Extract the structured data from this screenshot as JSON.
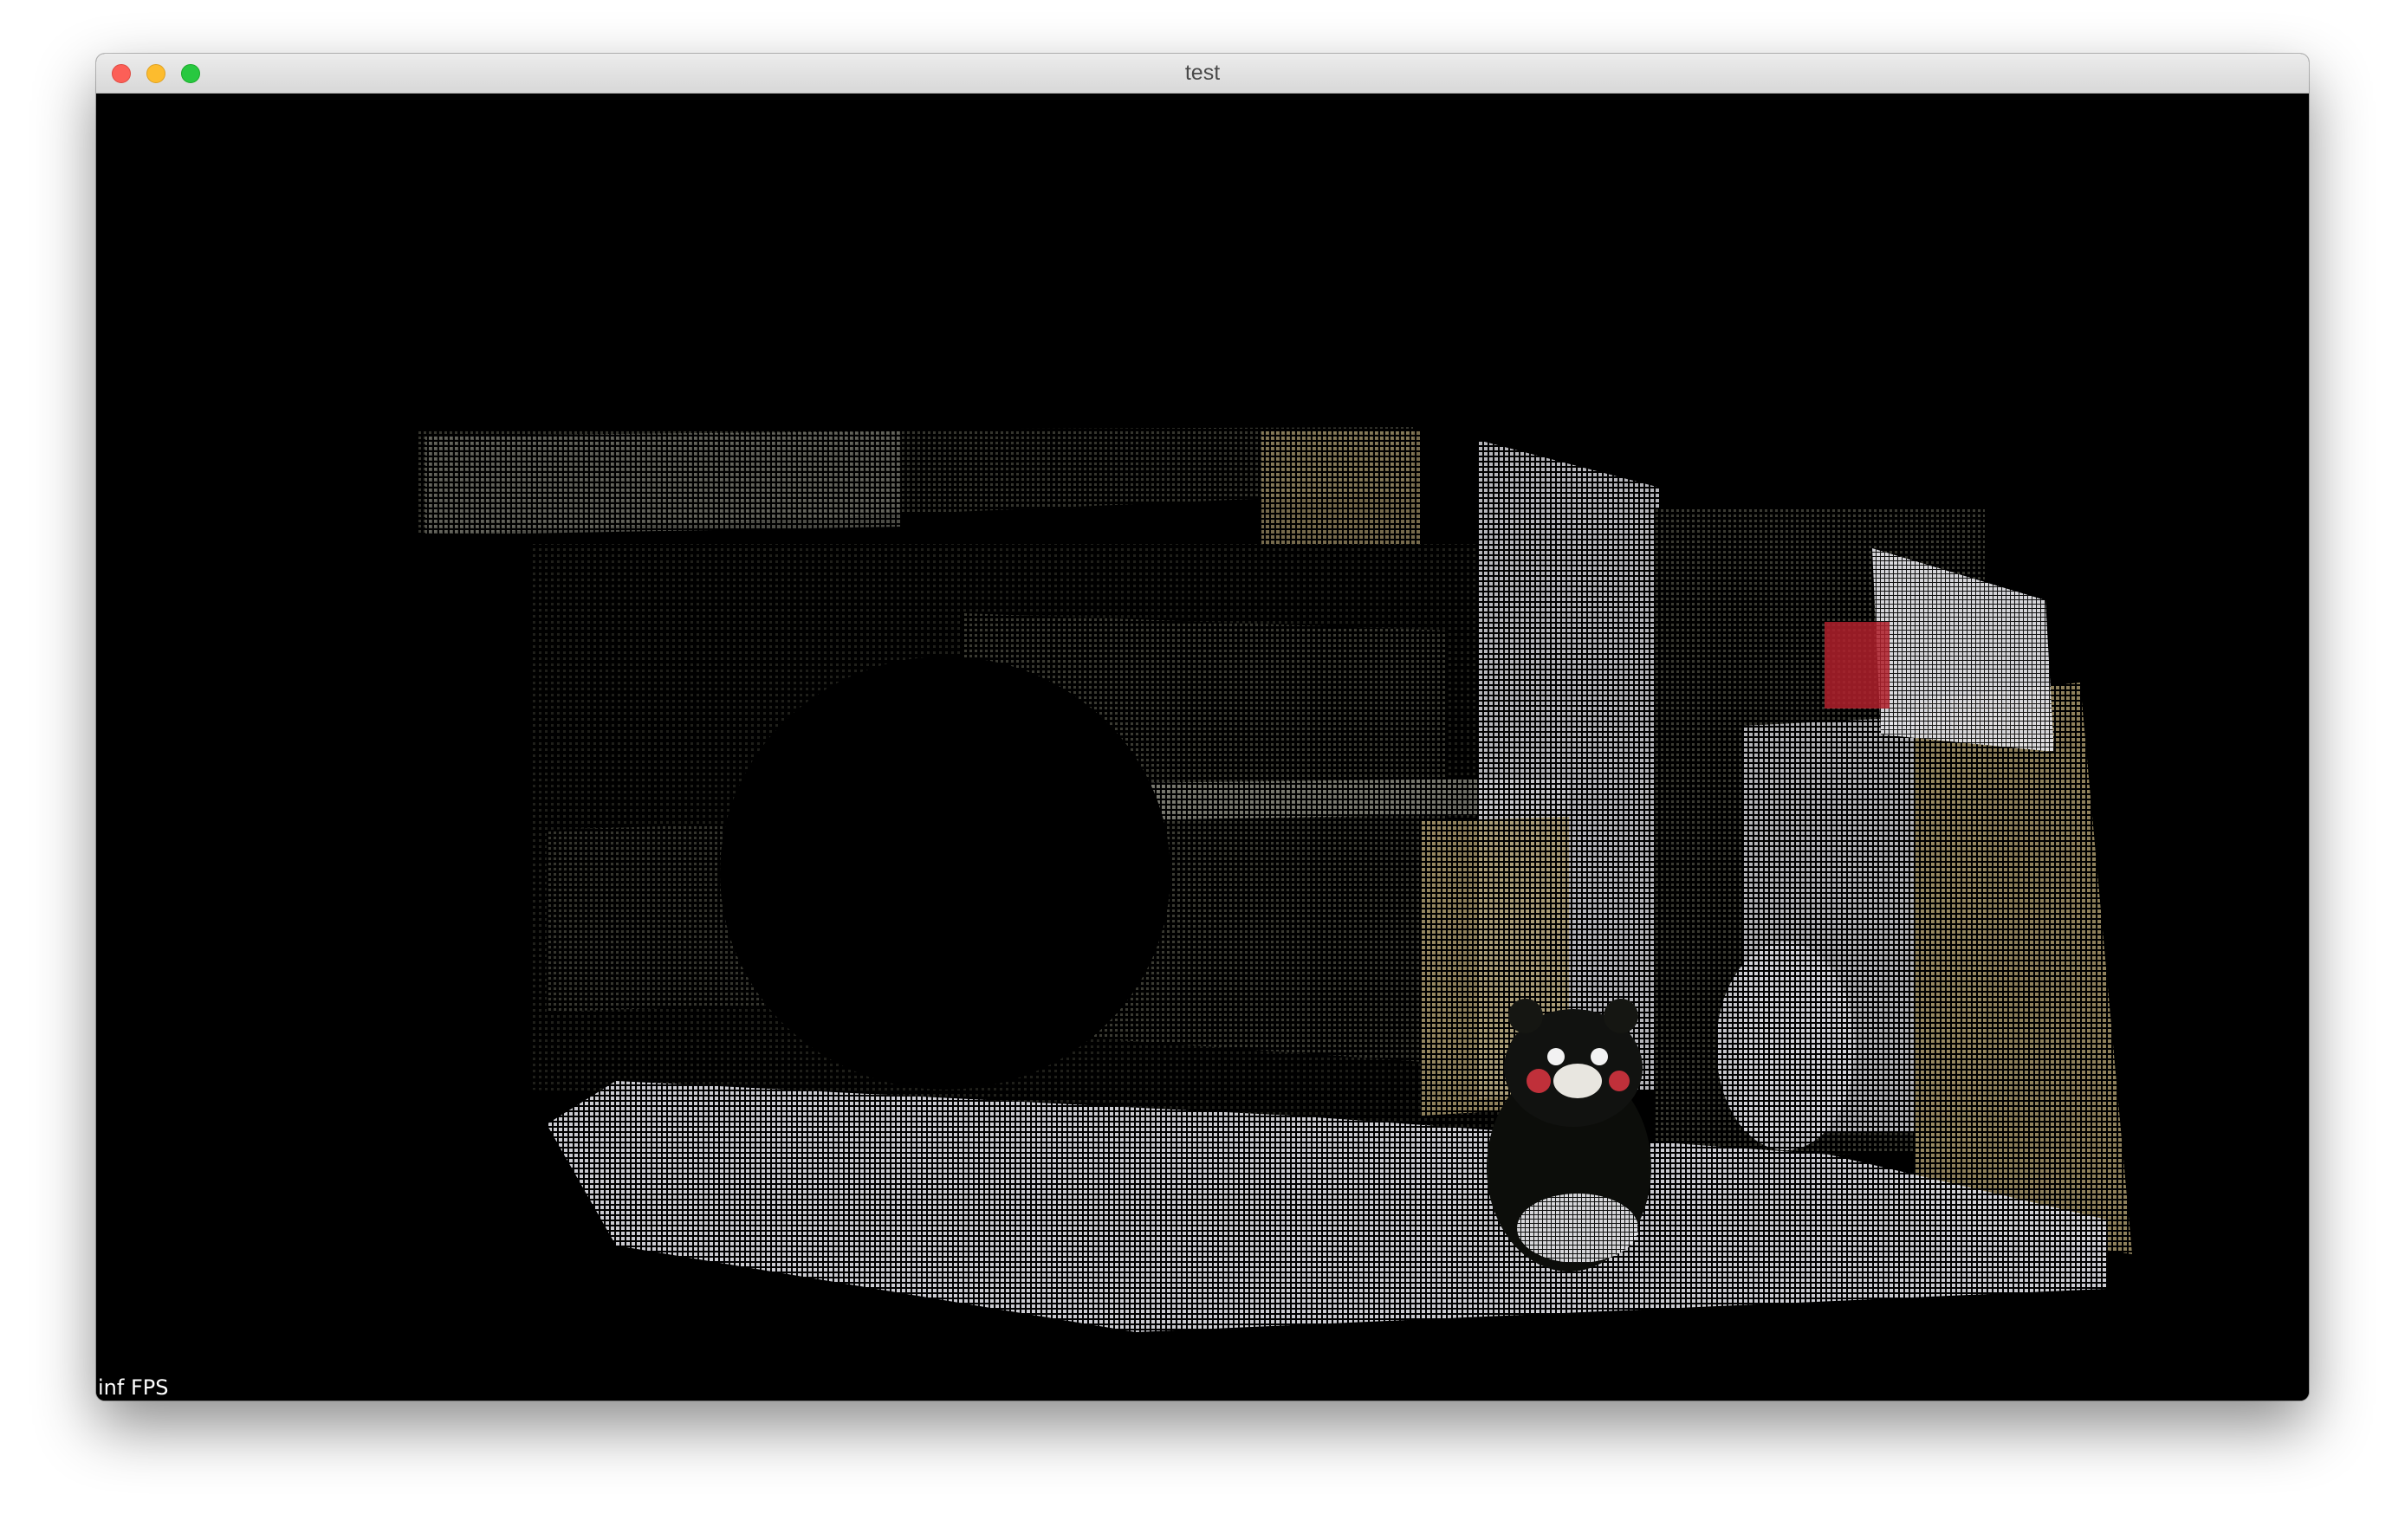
{
  "window": {
    "title": "test"
  },
  "viewport": {
    "fps_label": "inf FPS",
    "background_color": "#000000",
    "content": "point-cloud"
  },
  "colors": {
    "close": "#fc5f57",
    "minimize": "#fdbc2e",
    "maximize": "#28c840"
  }
}
